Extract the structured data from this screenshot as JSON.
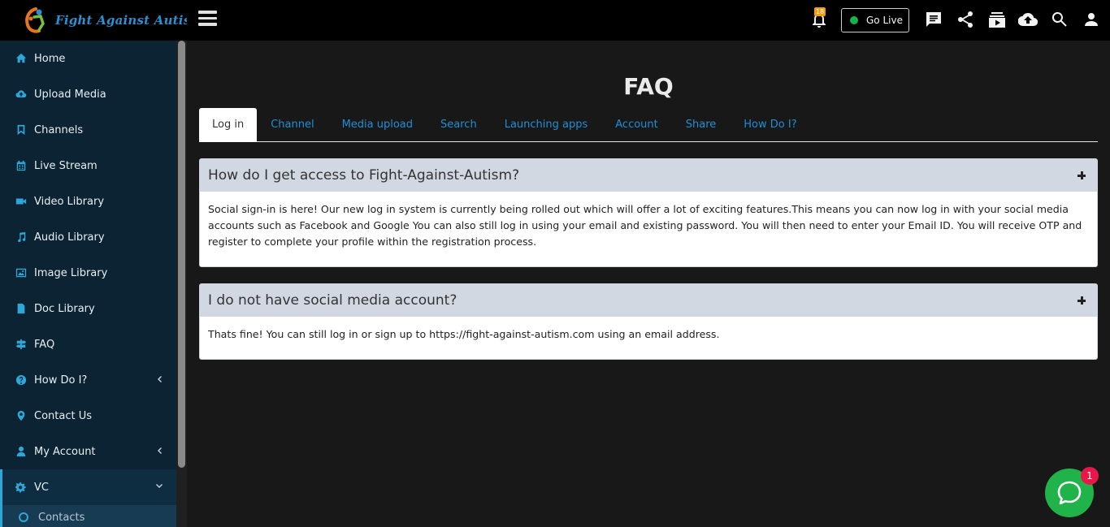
{
  "brand": {
    "name": "Fight Against Autism"
  },
  "sidebar": {
    "items": [
      {
        "label": "Home",
        "icon": "home-icon"
      },
      {
        "label": "Upload Media",
        "icon": "cloud-upload-icon"
      },
      {
        "label": "Channels",
        "icon": "bookmark-icon"
      },
      {
        "label": "Live Stream",
        "icon": "calendar-icon"
      },
      {
        "label": "Video Library",
        "icon": "video-camera-icon"
      },
      {
        "label": "Audio Library",
        "icon": "music-note-icon"
      },
      {
        "label": "Image Library",
        "icon": "image-icon"
      },
      {
        "label": "Doc Library",
        "icon": "document-icon"
      },
      {
        "label": "FAQ",
        "icon": "signpost-icon"
      },
      {
        "label": "How Do I?",
        "icon": "question-icon"
      },
      {
        "label": "Contact Us",
        "icon": "map-pin-icon"
      },
      {
        "label": "My Account",
        "icon": "user-icon"
      },
      {
        "label": "VC",
        "icon": "gears-icon"
      }
    ],
    "sub_items": [
      {
        "label": "Contacts",
        "icon": "circle-icon"
      }
    ]
  },
  "topbar": {
    "notification_count": "18",
    "go_live_label": "Go Live",
    "icons": [
      "bell-icon",
      "chat-icon",
      "share-icon",
      "subscriptions-icon",
      "cloud-upload-icon",
      "search-icon",
      "user-icon"
    ]
  },
  "page": {
    "title": "FAQ",
    "tabs": [
      {
        "label": "Log in",
        "active": true
      },
      {
        "label": "Channel"
      },
      {
        "label": "Media upload"
      },
      {
        "label": "Search"
      },
      {
        "label": "Launching apps"
      },
      {
        "label": "Account"
      },
      {
        "label": "Share"
      },
      {
        "label": "How Do I?"
      }
    ],
    "faqs": [
      {
        "question": "How do I get access to Fight-Against-Autism?",
        "answer": "Social sign-in is here! Our new log in system is currently being rolled out which will offer a lot of exciting features.This means you can now log in with your social media accounts such as Facebook and Google You can also still log in using your email and existing password. You will then need to enter your Email ID. You will receive OTP and register to complete your profile within the registration process."
      },
      {
        "question": "I do not have social media account?",
        "answer": "Thats fine! You can still log in or sign up to https://fight-against-autism.com using an email address."
      }
    ]
  },
  "chat_widget": {
    "unread": "1"
  },
  "colors": {
    "accent": "#2fa6d8",
    "sidebar_bg": "#0c2333",
    "link": "#1f8fd6",
    "live_dot": "#18b24b",
    "chat": "#1fb34a",
    "badge": "#e8174a"
  }
}
